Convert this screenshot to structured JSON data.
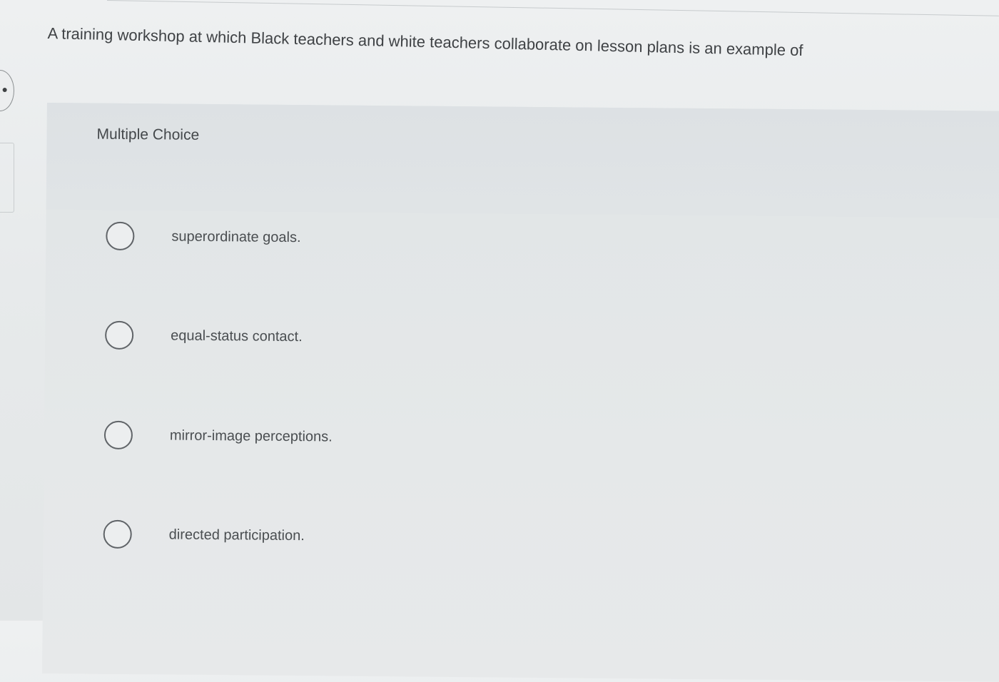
{
  "question": {
    "text": "A training workshop at which Black teachers and white teachers collaborate on lesson plans is an example of"
  },
  "panel": {
    "label": "Multiple Choice"
  },
  "options": [
    {
      "label": "superordinate goals."
    },
    {
      "label": "equal-status contact."
    },
    {
      "label": "mirror-image perceptions."
    },
    {
      "label": "directed participation."
    }
  ],
  "colors": {
    "background": "#e7eaeb",
    "panel": "#e0e4e6",
    "text": "#3f4245",
    "radio_border": "#606468"
  },
  "icons": {
    "side_nav": "nav-arrow-icon",
    "radio": "radio-unselected-icon"
  }
}
